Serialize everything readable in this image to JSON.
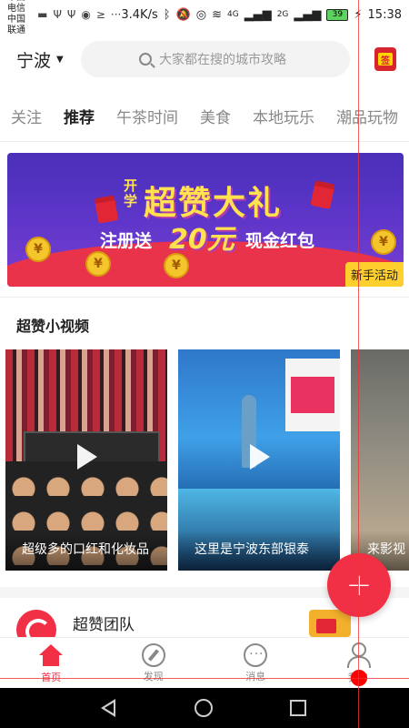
{
  "status_bar": {
    "carrier_1": "中国电信",
    "carrier_2": "中国联通",
    "more": "···",
    "speed": "3.4K/s",
    "signal_1": "4G",
    "signal_2": "2G",
    "battery": "39",
    "time": "15:38"
  },
  "header": {
    "city": "宁波",
    "search_placeholder": "大家都在搜的城市攻略",
    "signin_glyph": "签"
  },
  "tabs": [
    {
      "label": "关注",
      "active": false
    },
    {
      "label": "推荐",
      "active": true
    },
    {
      "label": "午茶时间",
      "active": false
    },
    {
      "label": "美食",
      "active": false
    },
    {
      "label": "本地玩乐",
      "active": false
    },
    {
      "label": "潮品玩物",
      "active": false
    }
  ],
  "banner": {
    "kai_xue": "开学",
    "title": "超赞大礼",
    "sub_left": "注册送",
    "amount": "20元",
    "sub_right": "现金红包",
    "badge": "新手活动",
    "coin_glyph": "¥"
  },
  "videos_section": {
    "title": "超赞小视频",
    "items": [
      {
        "caption": "超级多的口红和化妆品"
      },
      {
        "caption": "这里是宁波东部银泰"
      },
      {
        "caption": "来影视"
      }
    ]
  },
  "fab": {
    "label": "+"
  },
  "team": {
    "name": "超赞团队"
  },
  "bottom_nav": [
    {
      "label": "首页",
      "active": true
    },
    {
      "label": "发现",
      "active": false
    },
    {
      "label": "消息",
      "active": false
    },
    {
      "label": "我的",
      "active": false
    }
  ],
  "colors": {
    "accent": "#f23045",
    "banner_bg": "#5b35c8",
    "banner_title": "#ffe24d",
    "badge": "#ffcf2e"
  }
}
